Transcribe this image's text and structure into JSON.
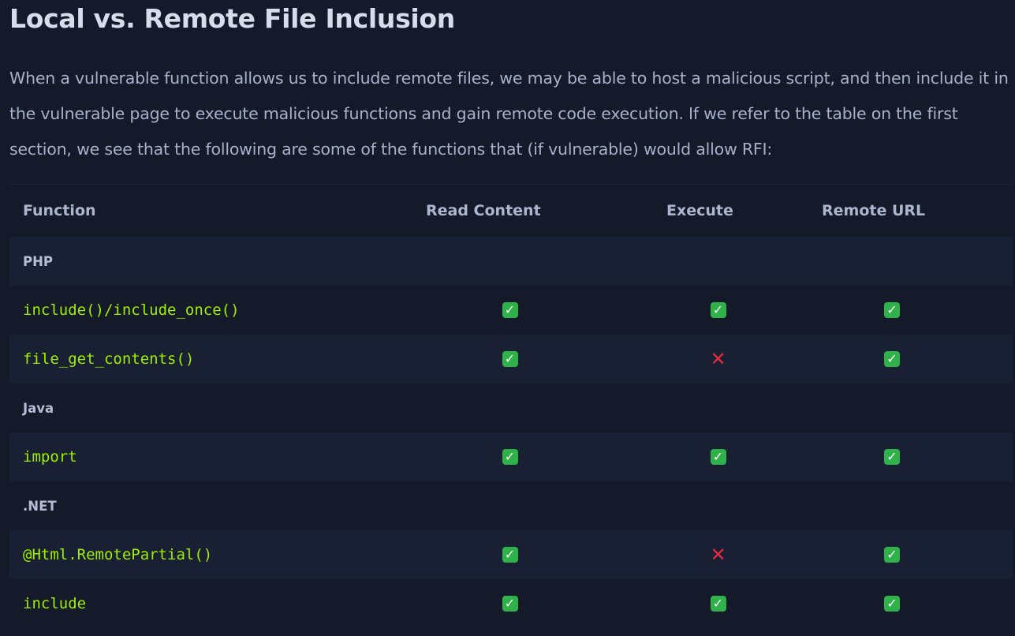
{
  "page": {
    "title": "Local vs. Remote File Inclusion",
    "paragraph": "When a vulnerable function allows us to include remote files, we may be able to host a malicious script, and then include it in the vulnerable page to execute malicious functions and gain remote code execution. If we refer to the table on the first section, we see that the following are some of the functions that (if vulnerable) would allow RFI:"
  },
  "table": {
    "headers": [
      "Function",
      "Read Content",
      "Execute",
      "Remote URL"
    ],
    "rows": [
      {
        "type": "group",
        "label": "PHP"
      },
      {
        "type": "item",
        "function": "include()/include_once()",
        "read": "yes",
        "execute": "yes",
        "remote": "yes"
      },
      {
        "type": "item",
        "function": "file_get_contents()",
        "read": "yes",
        "execute": "no",
        "remote": "yes"
      },
      {
        "type": "group",
        "label": "Java"
      },
      {
        "type": "item",
        "function": "import",
        "read": "yes",
        "execute": "yes",
        "remote": "yes"
      },
      {
        "type": "group",
        "label": ".NET"
      },
      {
        "type": "item",
        "function": "@Html.RemotePartial()",
        "read": "yes",
        "execute": "no",
        "remote": "yes"
      },
      {
        "type": "item",
        "function": "include",
        "read": "yes",
        "execute": "yes",
        "remote": "yes"
      }
    ]
  },
  "icons": {
    "yes": "check-mark-icon",
    "no": "cross-mark-icon"
  },
  "colors": {
    "background": "#151a2b",
    "row_shade": "#1a2033",
    "code_green": "#9fef00",
    "check_green": "#2fb24a",
    "cross_red": "#e8283d"
  }
}
